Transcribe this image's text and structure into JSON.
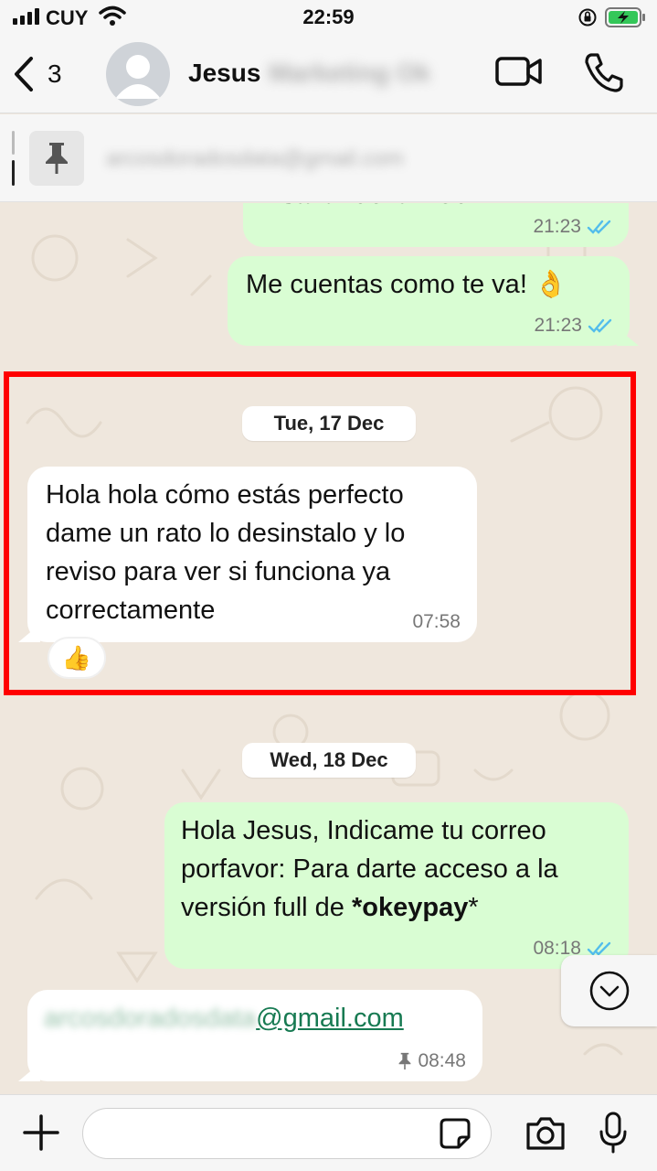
{
  "status_bar": {
    "carrier": "CUY",
    "time": "22:59"
  },
  "header": {
    "back_count": "3",
    "contact_name": "Jesus",
    "contact_name_blurred": "Marketing Ok",
    "icons": [
      "chevron-left-icon",
      "avatar-icon",
      "video-call-icon",
      "phone-icon"
    ]
  },
  "pinned": {
    "text_blurred": "arcosdoradosdata@gmail.com",
    "icon": "pin-icon"
  },
  "messages": [
    {
      "dir": "out",
      "text": "instalar de la web",
      "time": "21:23",
      "status": "read"
    },
    {
      "dir": "out",
      "text": "Me cuentas como te va! 👌",
      "time": "21:23",
      "status": "read"
    },
    {
      "type": "date",
      "label": "Tue, 17 Dec"
    },
    {
      "dir": "in",
      "text": "Hola hola cómo estás perfecto dame un rato lo desinstalo y lo reviso para ver si funciona ya correctamente",
      "time": "07:58",
      "reaction": "👍"
    },
    {
      "type": "date",
      "label": "Wed, 18 Dec"
    },
    {
      "dir": "out",
      "text_lines": [
        "Hola Jesus, Indicame tu correo",
        "porfavor: Para darte acceso a la",
        "versión full de "
      ],
      "bold": "*okeypay",
      "after_bold": "*",
      "time": "08:18",
      "status": "read"
    },
    {
      "dir": "in",
      "text_blurred": "arcosdoradosdata",
      "link": "@gmail.com",
      "time": "08:48",
      "pinned": true
    }
  ],
  "input": {
    "placeholder": ""
  },
  "colors": {
    "outgoing_bubble": "#d9fdd3",
    "incoming_bubble": "#ffffff",
    "chat_background": "#efe7dd",
    "read_ticks": "#53bdeb",
    "highlight_box": "#ff0000",
    "link": "#177a52"
  }
}
